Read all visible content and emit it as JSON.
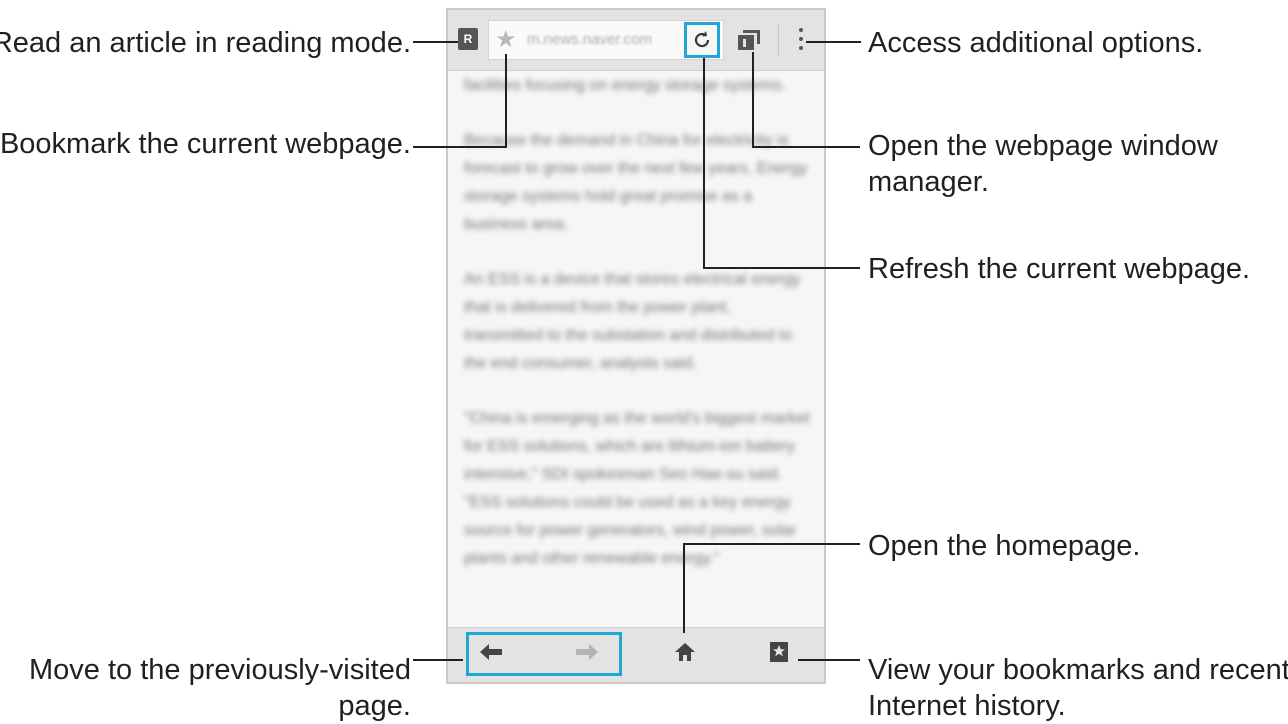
{
  "browser": {
    "url": "m.news.naver.com",
    "reader_icon_label": "R",
    "icons": [
      "reader-mode-icon",
      "star-icon",
      "refresh-icon",
      "windows-icon",
      "more-options-icon",
      "back-arrow-icon",
      "forward-arrow-icon",
      "home-icon",
      "bookmarks-icon"
    ],
    "article_paragraphs": [
      "facilities focusing on energy storage systems.",
      "Because the demand in China for electricity is forecast to grow over the next few years, Energy storage systems hold great promise as a business area.",
      "An ESS is a device that stores electrical energy that is delivered from the power plant, transmitted to the substation and distributed to the end consumer, analysts said.",
      "\"China is emerging as the world's biggest market for ESS solutions, which are lithium-ion battery intensive,\" SDI spokesman Seo Hae-su said. \"ESS solutions could be used as a key energy source for power generators, wind power, solar plants and other renewable energy.\""
    ]
  },
  "callouts": {
    "reading_mode": "Read an article in reading mode.",
    "bookmark": "Bookmark the current webpage.",
    "window_manager_1": "Open the webpage window",
    "window_manager_2": "manager.",
    "refresh": "Refresh the current webpage.",
    "options": "Access additional options.",
    "homepage": "Open the homepage.",
    "previous_1": "Move to the previously-visited",
    "previous_2": "page.",
    "bookmarks_1": "View your bookmarks and recent",
    "bookmarks_2": "Internet history."
  },
  "colors": {
    "accent": "#1fa6d6",
    "text": "#231f20"
  }
}
